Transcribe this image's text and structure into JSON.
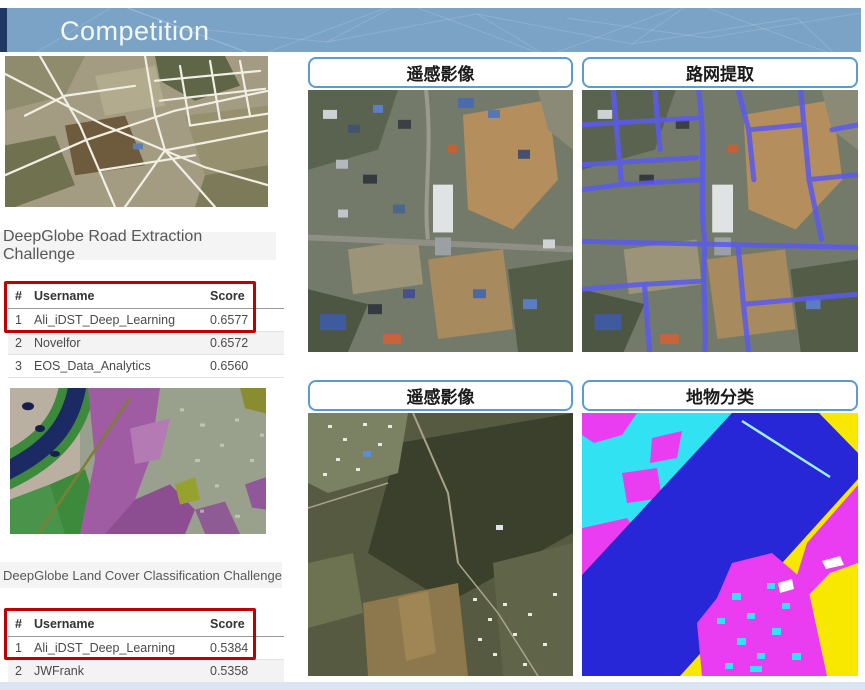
{
  "header": {
    "title": "Competition"
  },
  "left": {
    "road_challenge_title": "DeepGlobe Road Extraction Challenge",
    "road_table": {
      "headers": [
        "#",
        "Username",
        "Score"
      ],
      "rows": [
        [
          "1",
          "Ali_iDST_Deep_Learning",
          "0.6577"
        ],
        [
          "2",
          "Novelfor",
          "0.6572"
        ],
        [
          "3",
          "EOS_Data_Analytics",
          "0.6560"
        ]
      ]
    },
    "landcover_challenge_title": "DeepGlobe Land Cover Classification Challenge",
    "landcover_table": {
      "headers": [
        "#",
        "Username",
        "Score"
      ],
      "rows": [
        [
          "1",
          "Ali_iDST_Deep_Learning",
          "0.5384"
        ],
        [
          "2",
          "JWFrank",
          "0.5358"
        ]
      ]
    }
  },
  "right": {
    "road_pair": {
      "input_label": "遥感影像",
      "output_label": "路网提取"
    },
    "landcover_pair": {
      "input_label": "遥感影像",
      "output_label": "地物分类"
    }
  },
  "colors": {
    "header_bar": "#7ba3c6",
    "accent_strip": "#1f3864",
    "highlight_box": "#c00000",
    "label_border": "#5b9bd5",
    "footer_strip": "#d9e5f2"
  }
}
